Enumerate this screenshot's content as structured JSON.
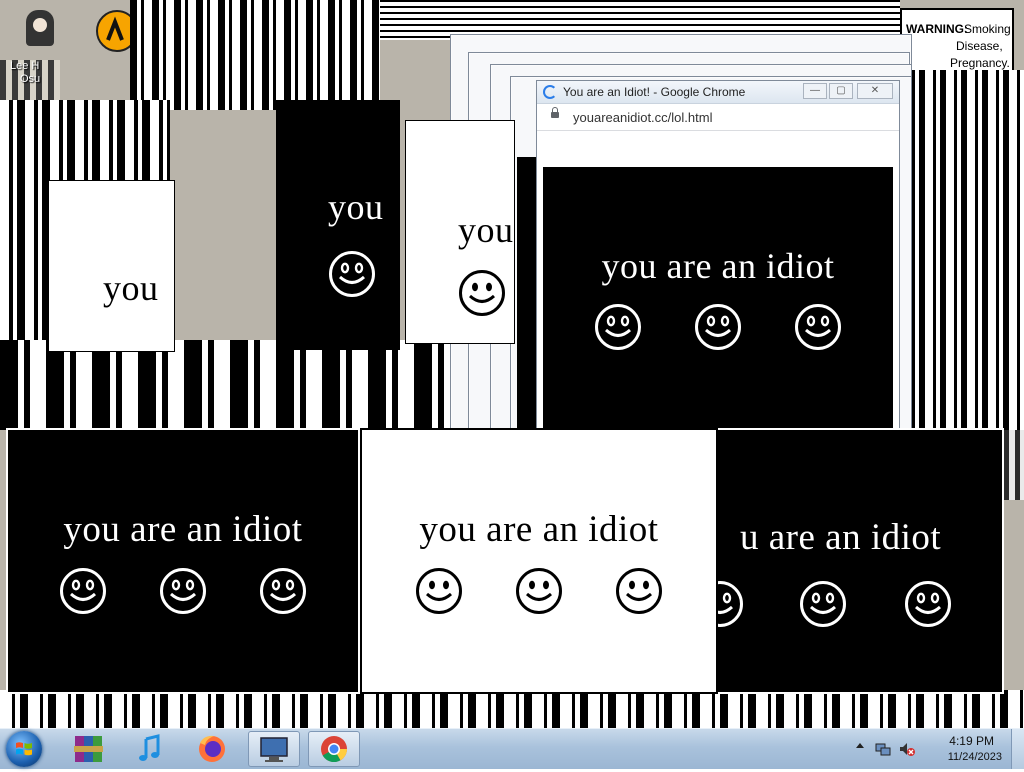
{
  "front_window": {
    "title": "You are an Idiot! - Google Chrome",
    "url": "youareanidiot.cc/lol.html"
  },
  "message": "you are an idiot",
  "message_partial": "you",
  "message_cut": "u are an idiot",
  "desktop": {
    "icon_label_1": "Lee H",
    "icon_label_2": "Osu"
  },
  "warning_sign": {
    "heading": "WARNING:",
    "text_1": "Smoking",
    "text_2": "Disease,",
    "text_3": "Pregnancy."
  },
  "taskbar": {
    "apps": [
      "start-orb",
      "winrar-icon",
      "itunes-icon",
      "firefox-icon",
      "computer-icon",
      "chrome-icon"
    ],
    "tray_icons": [
      "show-hidden-icons",
      "network-icon",
      "volume-muted-icon"
    ],
    "time": "4:19 PM",
    "date": "11/24/2023"
  },
  "colors": {
    "taskbar": "#a9c2dc",
    "panel_black": "#000000",
    "panel_white": "#ffffff",
    "chrome_accent": "#2b7de9"
  }
}
